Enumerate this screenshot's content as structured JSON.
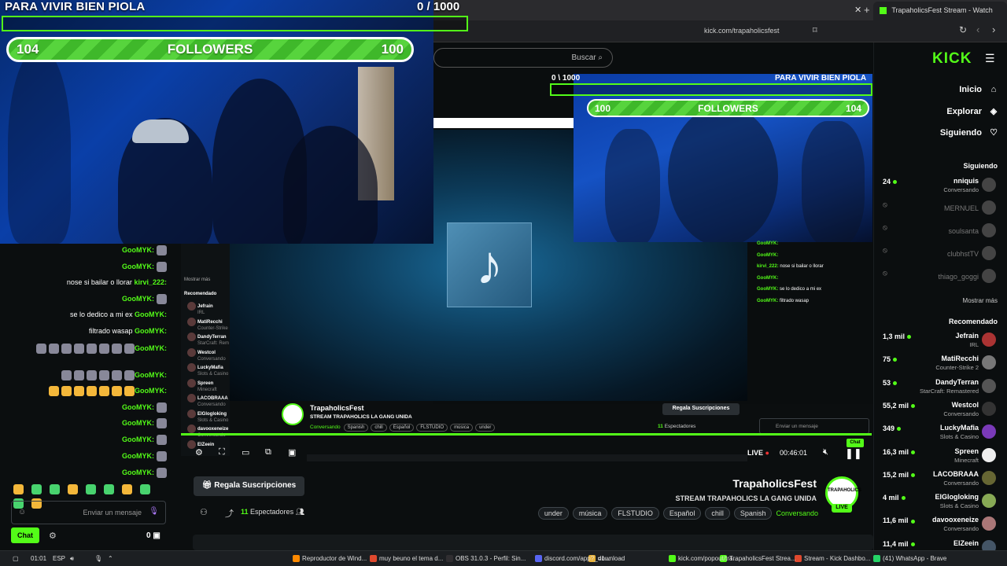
{
  "overlay": {
    "goal_title": "PARA VIVIR BIEN PIOLA",
    "goal_count": "0  / 1000",
    "followers_left": "104",
    "followers_label": "FOLLOWERS",
    "followers_right": "100",
    "accent": "#53fc18"
  },
  "mirror_overlay": {
    "goal_title": "PARA VIVIR BIEN PIOLA",
    "goal_count": "0  \\ 1000",
    "followers_left": "104",
    "followers_label": "FOLLOWERS",
    "followers_right": "100"
  },
  "browser": {
    "tab_title": "TrapaholicsFest Stream - Watch",
    "url": "kick.com/trapaholicsfest",
    "search_placeholder": "Buscar"
  },
  "sidebar": {
    "logo": "KICK",
    "nav": [
      {
        "label": "Inicio",
        "icon": "home-icon",
        "glyph": "⌂"
      },
      {
        "label": "Explorar",
        "icon": "compass-icon",
        "glyph": "◈"
      },
      {
        "label": "Siguiendo",
        "icon": "heart-icon",
        "glyph": "♡"
      }
    ],
    "following_title": "Siguiendo",
    "following": [
      {
        "name": "nniquis",
        "category": "Conversando",
        "count": "24",
        "online": true
      },
      {
        "name": "MERNUEL",
        "category": "",
        "count": "",
        "online": false
      },
      {
        "name": "soulsanta",
        "category": "",
        "count": "",
        "online": false
      },
      {
        "name": "clubhstTV",
        "category": "",
        "count": "",
        "online": false
      },
      {
        "name": "thiago_goggi",
        "category": "",
        "count": "",
        "online": false
      }
    ],
    "show_more": "Mostrar más",
    "recommended_title": "Recomendado",
    "recommended": [
      {
        "name": "Jefrain",
        "category": "IRL",
        "count": "1,3 mil"
      },
      {
        "name": "MatiRecchi",
        "category": "Counter-Strike 2",
        "count": "75"
      },
      {
        "name": "DandyTerran",
        "category": "StarCraft: Remastered",
        "count": "53"
      },
      {
        "name": "Westcol",
        "category": "Conversando",
        "count": "55,2 mil"
      },
      {
        "name": "LuckyMafia",
        "category": "Slots & Casino",
        "count": "349"
      },
      {
        "name": "Spreen",
        "category": "Minecraft",
        "count": "16,3 mil"
      },
      {
        "name": "LACOBRAAA",
        "category": "Conversando",
        "count": "15,2 mil"
      },
      {
        "name": "ElGlogloking",
        "category": "Slots & Casino",
        "count": "4 mil"
      },
      {
        "name": "davooxeneize",
        "category": "Conversando",
        "count": "11,6 mil"
      },
      {
        "name": "ElZeein",
        "category": "",
        "count": "11,4 mil"
      }
    ]
  },
  "chat": {
    "messages": [
      {
        "user": "GooMYK:",
        "text": "",
        "emotes": 1
      },
      {
        "user": "GooMYK:",
        "text": "",
        "emotes": 1
      },
      {
        "user": "kirvi_222:",
        "text": "nose si bailar o llorar",
        "emotes": 0
      },
      {
        "user": "GooMYK:",
        "text": "",
        "emotes": 1
      },
      {
        "user": "GooMYK:",
        "text": "se lo dedico a mi ex",
        "emotes": 0
      },
      {
        "user": "GooMYK:",
        "text": "filtrado wasap",
        "emotes": 0
      },
      {
        "user": "GooMYK:",
        "text": "",
        "emotes": 8
      },
      {
        "user": "GooMYK:",
        "text": "",
        "emotes": 6
      },
      {
        "user": "GooMYK:",
        "text": "",
        "emotes": 7
      },
      {
        "user": "GooMYK:",
        "text": "",
        "emotes": 1
      },
      {
        "user": "GooMYK:",
        "text": "",
        "emotes": 1
      },
      {
        "user": "GooMYK:",
        "text": "",
        "emotes": 1
      },
      {
        "user": "GooMYK:",
        "text": "",
        "emotes": 1
      },
      {
        "user": "GooMYK:",
        "text": "",
        "emotes": 1
      }
    ],
    "input_placeholder": "Enviar un mensaje",
    "send_label": "Chat",
    "points": "0"
  },
  "stream": {
    "name": "TrapaholicsFest",
    "title": "STREAM TRAPAHOLICS LA GANG UNIDA",
    "category": "Conversando",
    "tags": [
      "Spanish",
      "chill",
      "Español",
      "FLSTUDIO",
      "música",
      "under"
    ],
    "gift_label": "Regala Suscripciones",
    "viewers": "11",
    "viewers_label": "Espectadores",
    "live": "LIVE",
    "time": "00:46:01",
    "avatar_text": "TRAPAHOLICS"
  },
  "mini_sidebar": {
    "show_more": "Mostrar más",
    "recommended": "Recomendado",
    "items": [
      {
        "name": "Jefrain",
        "cat": "IRL"
      },
      {
        "name": "MatiRecchi",
        "cat": "Counter-Strike"
      },
      {
        "name": "DandyTerran",
        "cat": "StarCraft: Rem"
      },
      {
        "name": "Westcol",
        "cat": "Conversando"
      },
      {
        "name": "LuckyMafia",
        "cat": "Slots & Casino"
      },
      {
        "name": "Spreen",
        "cat": "Minecraft"
      },
      {
        "name": "LACOBRAAA",
        "cat": "Conversando"
      },
      {
        "name": "ElGlogloking",
        "cat": "Slots & Casino"
      },
      {
        "name": "davooxeneize",
        "cat": "Conversando"
      },
      {
        "name": "ElZeein",
        "cat": ""
      }
    ]
  },
  "mini_stream": {
    "name": "TrapaholicsFest",
    "title": "STREAM TRAPAHOLICS LA GANG UNIDA",
    "category": "Conversando",
    "tags": [
      "Spanish",
      "chill",
      "Español",
      "FLSTUDIO",
      "música",
      "under"
    ],
    "gift_label": "Regala Suscripciones",
    "viewers": "11",
    "viewers_label": "Espectadores",
    "chat_placeholder": "Enviar un mensaje",
    "chat_btn": "Chat",
    "time": "00:46:01",
    "live": "LIVE"
  },
  "mini_chat": [
    {
      "user": "GooMYK:",
      "text": ""
    },
    {
      "user": "GooMYK:",
      "text": ""
    },
    {
      "user": "kirvi_222:",
      "text": "nose si bailar o llorar"
    },
    {
      "user": "GooMYK:",
      "text": ""
    },
    {
      "user": "GooMYK:",
      "text": "se lo dedico a mi ex"
    },
    {
      "user": "GooMYK:",
      "text": "filtrado wasap"
    }
  ],
  "taskbar": {
    "time": "01:01",
    "lang": "ESP",
    "items": [
      "(41) WhatsApp - Brave",
      "Stream - Kick Dashbo...",
      "TrapaholicsFest Strea...",
      "kick.com/popout/tra...",
      "download",
      "discord.com/app?_=1...",
      "OBS 31.0.3 - Perfil: Sin...",
      "muy beuno el tema d...",
      "Reproductor de Wind..."
    ]
  }
}
